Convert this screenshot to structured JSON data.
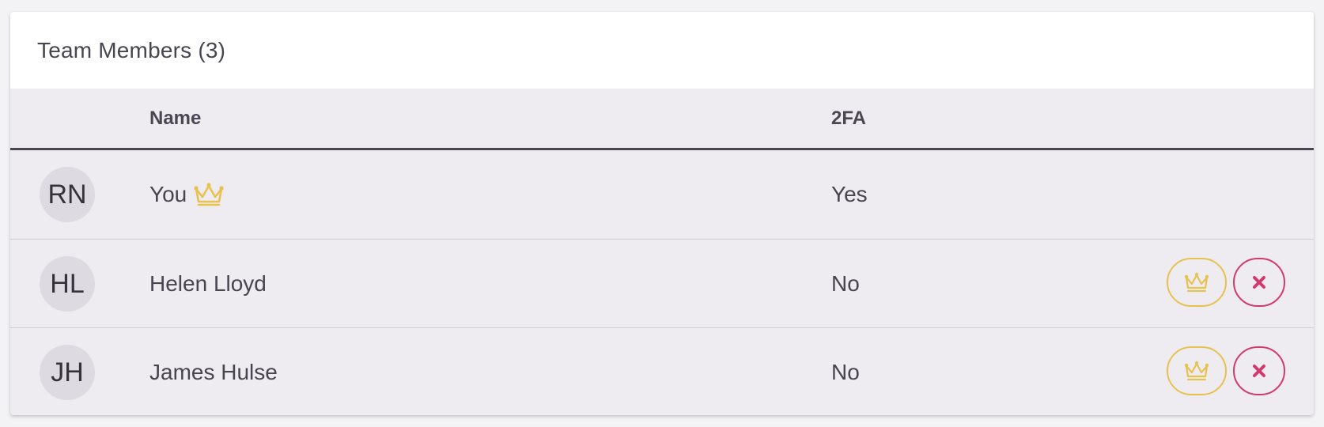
{
  "card": {
    "title": "Team Members (3)"
  },
  "table": {
    "columns": {
      "name": "Name",
      "twofa": "2FA"
    },
    "rows": [
      {
        "initials": "RN",
        "name": "You",
        "twofa": "Yes",
        "is_owner": true,
        "actions": false
      },
      {
        "initials": "HL",
        "name": "Helen Lloyd",
        "twofa": "No",
        "is_owner": false,
        "actions": true
      },
      {
        "initials": "JH",
        "name": "James Hulse",
        "twofa": "No",
        "is_owner": false,
        "actions": true
      }
    ]
  },
  "icons": {
    "owner": "crown-icon",
    "make_owner": "crown-icon",
    "remove": "close-icon"
  },
  "colors": {
    "crown": "#e8c24f",
    "remove": "#d13a6a",
    "text": "#48454f",
    "header_border": "#4a4753"
  }
}
